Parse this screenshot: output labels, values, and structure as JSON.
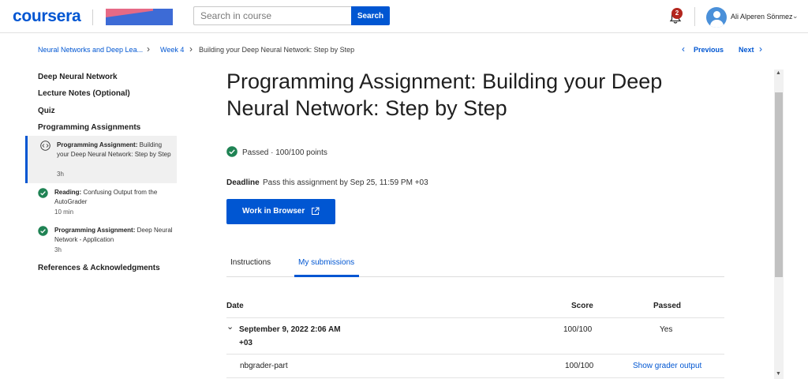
{
  "header": {
    "logo": "coursera",
    "search_placeholder": "Search in course",
    "search_button": "Search",
    "notification_count": "2",
    "user_name": "Ali Alperen Sönmez"
  },
  "breadcrumb": {
    "course": "Neural Networks and Deep Lea...",
    "week": "Week 4",
    "current": "Building your Deep Neural Network: Step by Step"
  },
  "nav": {
    "previous": "Previous",
    "next": "Next"
  },
  "sidebar": {
    "headings": [
      "Deep Neural Network",
      "Lecture Notes (Optional)",
      "Quiz",
      "Programming Assignments",
      "References & Acknowledgments"
    ],
    "items": [
      {
        "type": "Programming Assignment:",
        "title": "Building your Deep Neural Network: Step by Step",
        "duration": "3h"
      },
      {
        "type": "Reading:",
        "title": "Confusing Output from the AutoGrader",
        "duration": "10 min"
      },
      {
        "type": "Programming Assignment:",
        "title": "Deep Neural Network - Application",
        "duration": "3h"
      }
    ]
  },
  "main": {
    "title": "Programming Assignment: Building your Deep Neural Network: Step by Step",
    "status": "Passed · 100/100 points",
    "deadline_label": "Deadline",
    "deadline_text": "Pass this assignment by Sep 25, 11:59 PM +03",
    "work_button": "Work in Browser",
    "tabs": [
      "Instructions",
      "My submissions"
    ],
    "table": {
      "headers": {
        "date": "Date",
        "score": "Score",
        "passed": "Passed"
      },
      "submission": {
        "date_line1": "September 9, 2022 2:06 AM",
        "date_line2": "+03",
        "score": "100/100",
        "passed": "Yes"
      },
      "part": {
        "name": "nbgrader-part",
        "score": "100/100",
        "action": "Show grader output"
      }
    }
  },
  "colors": {
    "brand": "#0056d2",
    "success": "#1f8354",
    "badge": "#b3261e"
  }
}
